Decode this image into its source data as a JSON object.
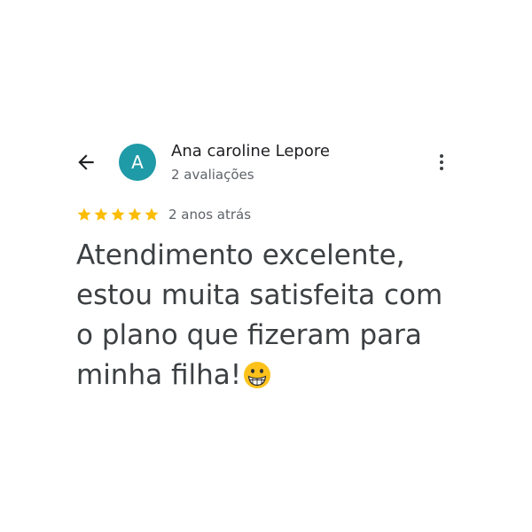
{
  "header": {
    "back_icon": "arrow-back-icon",
    "more_icon": "more-vert-icon"
  },
  "reviewer": {
    "avatar_letter": "A",
    "avatar_color": "#1f9aa7",
    "name": "Ana caroline Lepore",
    "review_count": "2 avaliações"
  },
  "review": {
    "rating": 5,
    "rating_max": 5,
    "star_color": "#fbbc04",
    "date": "2 anos atrás",
    "text": "Atendimento excelente, estou muita satisfeita com o plano que fizeram para minha filha!",
    "emoji": "grinning-face-emoji"
  }
}
